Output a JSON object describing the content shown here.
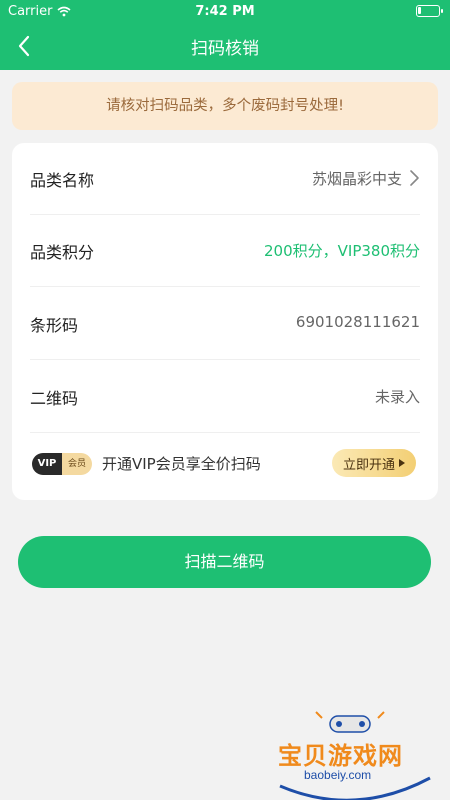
{
  "status_bar": {
    "carrier": "Carrier",
    "time": "7:42 PM",
    "icons": [
      "wifi-icon",
      "battery-icon"
    ]
  },
  "navbar": {
    "title": "扫码核销",
    "back_icon": "chevron-left-icon"
  },
  "notice": {
    "text": "请核对扫码品类，多个废码封号处理!"
  },
  "details": {
    "category_name": {
      "label": "品类名称",
      "value": "苏烟晶彩中支"
    },
    "category_points": {
      "label": "品类积分",
      "value": "200积分，VIP380积分"
    },
    "barcode": {
      "label": "条形码",
      "value": "6901028111621"
    },
    "qrcode": {
      "label": "二维码",
      "value": "未录入"
    }
  },
  "vip": {
    "badge_left": "VIP",
    "badge_right": "会员",
    "text": "开通VIP会员享全价扫码",
    "button_label": "立即开通"
  },
  "scan_button": {
    "label": "扫描二维码"
  },
  "watermark": {
    "text": "宝贝游戏网",
    "url": "baobeiy.com"
  },
  "colors": {
    "brand_green": "#1ebf73",
    "notice_bg": "#fcead3",
    "notice_text": "#9b6a3c",
    "vip_gold": "#f3cf74"
  }
}
